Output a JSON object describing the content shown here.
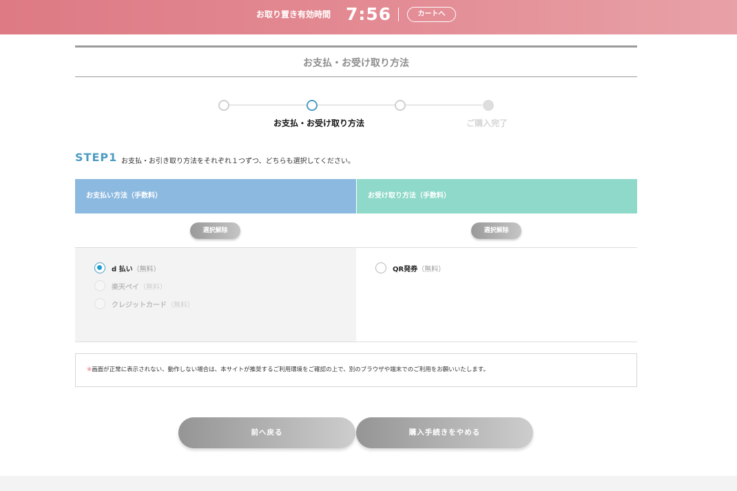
{
  "timer": {
    "label": "お取り置き有効時間",
    "value": "7:56",
    "cart_label": "カートへ"
  },
  "page_title": "お支払・お受け取り方法",
  "steps": [
    {
      "label": "",
      "state": "done"
    },
    {
      "label": "お支払・お受け取り方法",
      "state": "active"
    },
    {
      "label": "",
      "state": "pending"
    },
    {
      "label": "ご購入完了",
      "state": "pending"
    }
  ],
  "step1": {
    "heading": "STEP1",
    "description": "お支払・お引き取り方法をそれぞれ１つずつ、どちらも選択してください。"
  },
  "payment": {
    "header": "お支払い方法（手数料）",
    "clear_label": "選択解除",
    "options": [
      {
        "name": "d 払い",
        "fee": "（無料）",
        "selected": true,
        "disabled": false
      },
      {
        "name": "楽天ペイ",
        "fee": "（無料）",
        "selected": false,
        "disabled": true
      },
      {
        "name": "クレジットカード",
        "fee": "（無料）",
        "selected": false,
        "disabled": true
      }
    ]
  },
  "receipt": {
    "header": "お受け取り方法（手数料）",
    "clear_label": "選択解除",
    "options": [
      {
        "name": "QR発券",
        "fee": "（無料）",
        "selected": false,
        "disabled": false
      }
    ]
  },
  "note": {
    "mark": "※",
    "text": "画面が正常に表示されない、動作しない場合は、本サイトが推奨するご利用環境をご確認の上で、別のブラウザや端末でのご利用をお願いいたします。"
  },
  "buttons": {
    "back": "前へ戻る",
    "cancel": "購入手続きをやめる"
  },
  "colors": {
    "accent": "#4b9cc2",
    "topbar": "#e38a93",
    "payment_header": "#8cb9e0",
    "receipt_header": "#8ed9c9"
  }
}
